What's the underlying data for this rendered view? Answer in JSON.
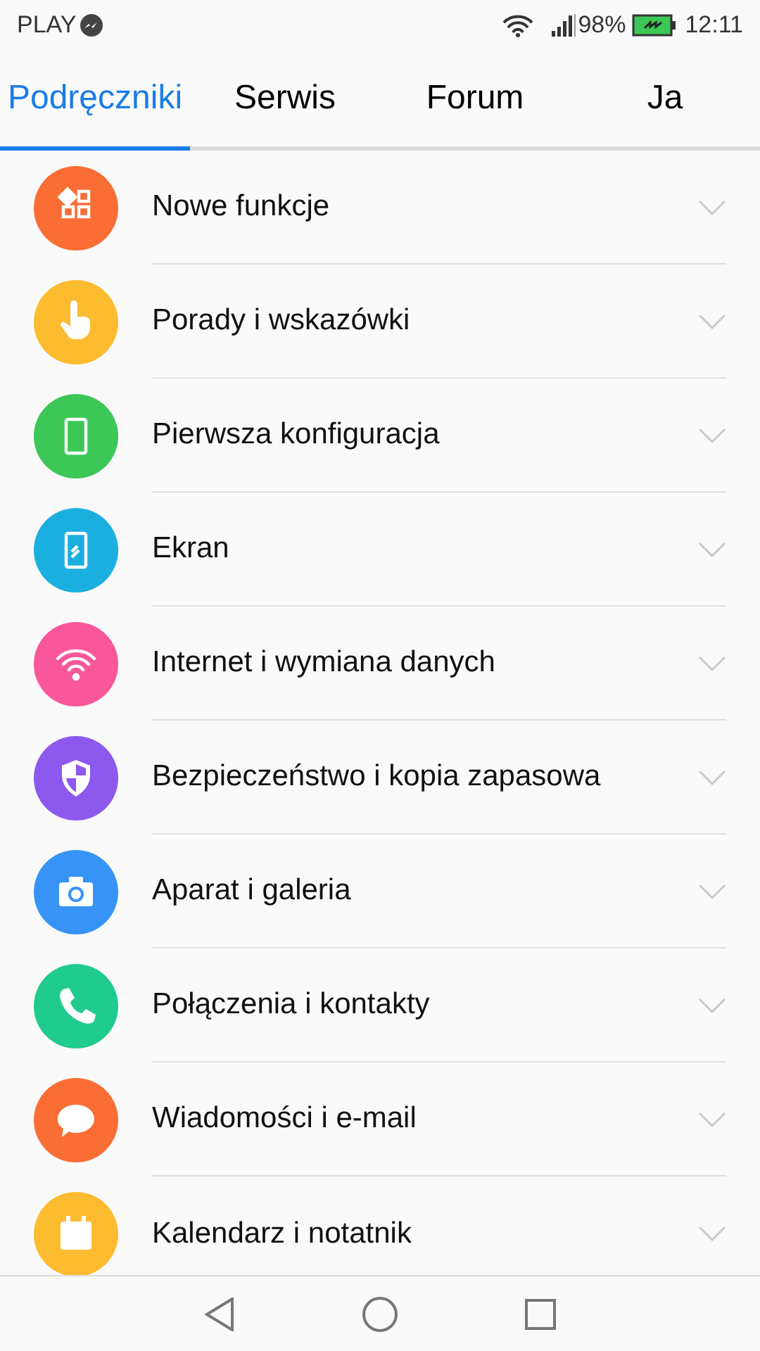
{
  "status_bar": {
    "carrier": "PLAY",
    "battery": "98%",
    "time": "12:11"
  },
  "tabs": [
    {
      "label": "Podręczniki",
      "selected": true
    },
    {
      "label": "Serwis",
      "selected": false
    },
    {
      "label": "Forum",
      "selected": false
    },
    {
      "label": "Ja",
      "selected": false
    }
  ],
  "items": [
    {
      "label": "Nowe funkcje",
      "color": "#fa6e36"
    },
    {
      "label": "Porady i wskazówki",
      "color": "#fdbb2f"
    },
    {
      "label": "Pierwsza konfiguracja",
      "color": "#3cc757"
    },
    {
      "label": "Ekran",
      "color": "#1bafe0"
    },
    {
      "label": "Internet i wymiana danych",
      "color": "#f9579a"
    },
    {
      "label": "Bezpieczeństwo i kopia zapasowa",
      "color": "#8d58ed"
    },
    {
      "label": "Aparat i galeria",
      "color": "#3794f6"
    },
    {
      "label": "Połączenia i kontakty",
      "color": "#1fcb8d"
    },
    {
      "label": "Wiadomości i e-mail",
      "color": "#fa6e36"
    },
    {
      "label": "Kalendarz i notatnik",
      "color": "#fdbb2f"
    }
  ]
}
